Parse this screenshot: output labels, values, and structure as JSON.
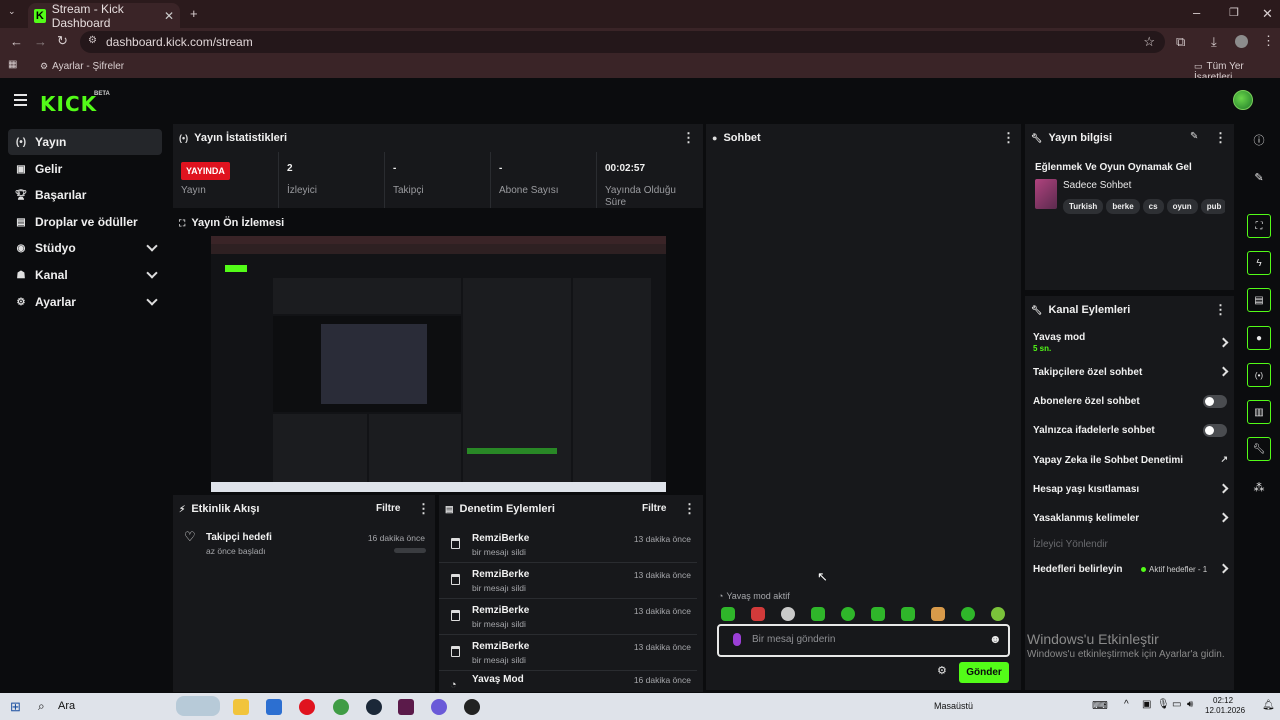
{
  "browser": {
    "tab_title": "Stream - Kick Dashboard",
    "url": "dashboard.kick.com/stream",
    "bookmark_item": "Ayarlar - Şifreler",
    "bookmarks_all": "Tüm Yer İşaretleri",
    "new_tab": "+",
    "close_tab": "✕"
  },
  "header": {
    "logo": "KICK",
    "beta": "BETA"
  },
  "sidebar": {
    "items": [
      {
        "label": "Yayın",
        "icon": "broadcast-icon"
      },
      {
        "label": "Gelir",
        "icon": "money-icon"
      },
      {
        "label": "Başarılar",
        "icon": "trophy-icon"
      },
      {
        "label": "Droplar ve ödüller",
        "icon": "gift-icon"
      },
      {
        "label": "Stüdyo",
        "icon": "studio-icon"
      },
      {
        "label": "Kanal",
        "icon": "users-icon"
      },
      {
        "label": "Ayarlar",
        "icon": "gear-icon"
      }
    ]
  },
  "stats": {
    "title": "Yayın İstatistikleri",
    "live_badge": "YAYINDA",
    "cells": [
      {
        "value": "",
        "label": "Yayın"
      },
      {
        "value": "2",
        "label": "İzleyici"
      },
      {
        "value": "-",
        "label": "Takipçi"
      },
      {
        "value": "-",
        "label": "Abone Sayısı"
      },
      {
        "value": "00:02:57",
        "label": "Yayında Olduğu Süre"
      }
    ]
  },
  "preview": {
    "title": "Yayın Ön İzlemesi"
  },
  "activity": {
    "title": "Etkinlik Akışı",
    "filter": "Filtre",
    "items": [
      {
        "name": "Takipçi hedefi",
        "sub": "az önce başladı",
        "time": "16 dakika önce"
      }
    ]
  },
  "moderation": {
    "title": "Denetim Eylemleri",
    "filter": "Filtre",
    "items": [
      {
        "name": "RemziBerke",
        "sub": "bir mesajı sildi",
        "time": "13 dakika önce"
      },
      {
        "name": "RemziBerke",
        "sub": "bir mesajı sildi",
        "time": "13 dakika önce"
      },
      {
        "name": "RemziBerke",
        "sub": "bir mesajı sildi",
        "time": "13 dakika önce"
      },
      {
        "name": "RemziBerke",
        "sub": "bir mesajı sildi",
        "time": "13 dakika önce"
      },
      {
        "name": "Yavaş Mod",
        "sub": "",
        "time": "16 dakika önce"
      }
    ]
  },
  "chat": {
    "title": "Sohbet",
    "slow_mode_notice": "Yavaş mod aktif",
    "placeholder": "Bir mesaj gönderin",
    "send": "Gönder"
  },
  "stream_info": {
    "title": "Yayın bilgisi",
    "stream_title": "Eğlenmek Ve Oyun Oynamak Gel",
    "category": "Sadece Sohbet",
    "tags": [
      "Turkish",
      "berke",
      "cs",
      "oyun",
      "pub"
    ]
  },
  "channel_actions": {
    "title": "Kanal Eylemleri",
    "slow_mode": "Yavaş mod",
    "slow_mode_value": "5 sn.",
    "followers_only": "Takipçilere özel sohbet",
    "subscribers_only": "Abonelere özel sohbet",
    "emotes_only": "Yalnızca ifadelerle sohbet",
    "ai_moderation": "Yapay Zeka ile Sohbet Denetimi",
    "account_age": "Hesap yaşı kısıtlaması",
    "banned_words": "Yasaklanmış kelimeler",
    "raid": "İzleyici Yönlendir",
    "goals": "Hedefleri belirleyin",
    "goals_status": "Aktif hedefler - 1"
  },
  "windows": {
    "activate_title": "Windows'u Etkinleştir",
    "activate_sub": "Windows'u etkinleştirmek için Ayarlar'a gidin.",
    "search": "Ara",
    "desktop": "Masaüstü",
    "time": "02:12",
    "date": "12.01.2026"
  },
  "colors": {
    "brand": "#53fc18",
    "live": "#e0131f"
  }
}
